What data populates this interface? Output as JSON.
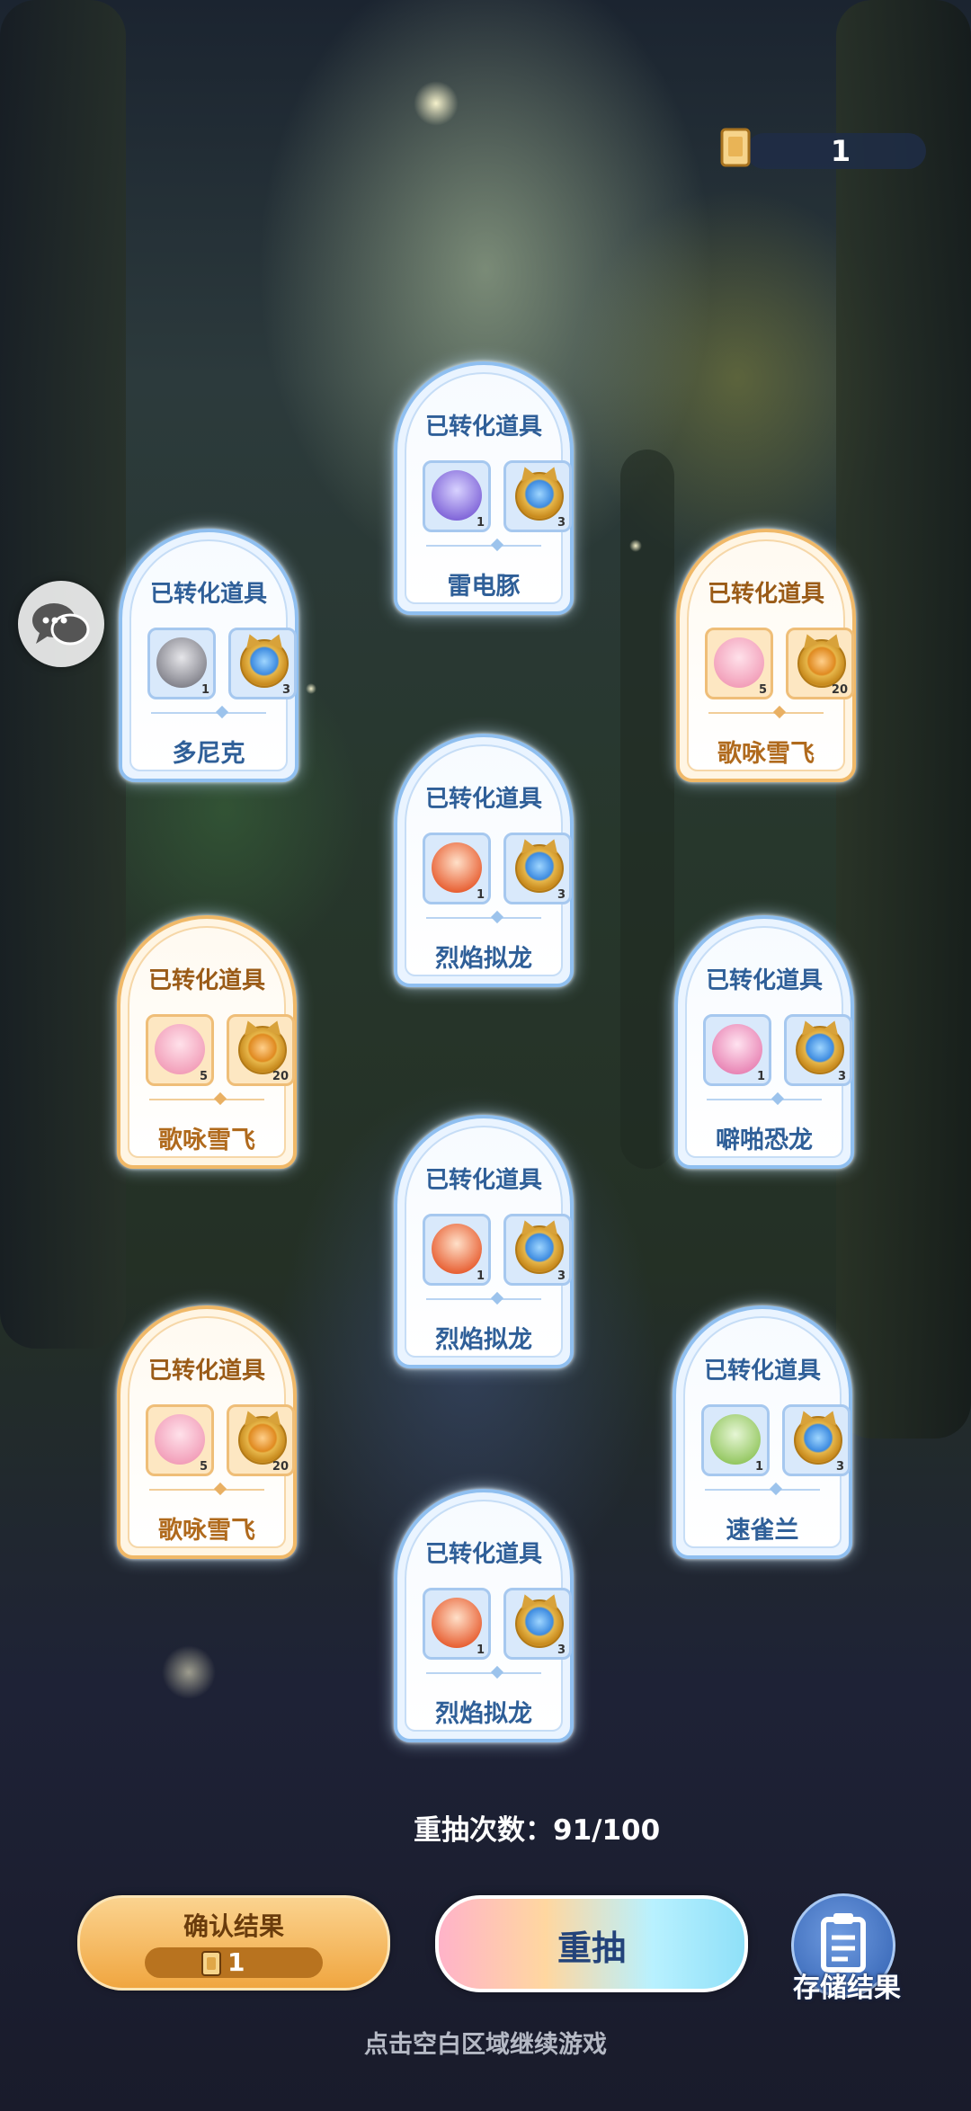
{
  "top_counter": {
    "value": "1",
    "icon": "ticket-icon"
  },
  "chat_button": {
    "icon": "chat-bubbles-icon"
  },
  "cards": [
    {
      "header": "已转化道具",
      "pet_count": "1",
      "item_count": "3",
      "name": "雷电豚",
      "theme": "blue",
      "pet_icon": "purple-pet-icon"
    },
    {
      "header": "已转化道具",
      "pet_count": "1",
      "item_count": "3",
      "name": "多尼克",
      "theme": "blue",
      "pet_icon": "gray-cat-pet-icon"
    },
    {
      "header": "已转化道具",
      "pet_count": "5",
      "item_count": "20",
      "name": "歌咏雪飞",
      "theme": "orange",
      "pet_icon": "pink-pet-icon"
    },
    {
      "header": "已转化道具",
      "pet_count": "1",
      "item_count": "3",
      "name": "烈焰拟龙",
      "theme": "blue",
      "pet_icon": "orange-dragon-pet-icon"
    },
    {
      "header": "已转化道具",
      "pet_count": "5",
      "item_count": "20",
      "name": "歌咏雪飞",
      "theme": "orange",
      "pet_icon": "pink-pet-icon"
    },
    {
      "header": "已转化道具",
      "pet_count": "1",
      "item_count": "3",
      "name": "噼啪恐龙",
      "theme": "blue",
      "pet_icon": "pink-dino-pet-icon"
    },
    {
      "header": "已转化道具",
      "pet_count": "1",
      "item_count": "3",
      "name": "烈焰拟龙",
      "theme": "blue",
      "pet_icon": "orange-dragon-pet-icon"
    },
    {
      "header": "已转化道具",
      "pet_count": "5",
      "item_count": "20",
      "name": "歌咏雪飞",
      "theme": "orange",
      "pet_icon": "pink-pet-icon"
    },
    {
      "header": "已转化道具",
      "pet_count": "1",
      "item_count": "3",
      "name": "速雀兰",
      "theme": "blue",
      "pet_icon": "green-bird-pet-icon"
    },
    {
      "header": "已转化道具",
      "pet_count": "1",
      "item_count": "3",
      "name": "烈焰拟龙",
      "theme": "blue",
      "pet_icon": "orange-dragon-pet-icon"
    }
  ],
  "reroll_count_text": "重抽次数：91/100",
  "confirm_button": {
    "label": "确认结果",
    "cost": "1"
  },
  "reroll_button": {
    "label": "重抽"
  },
  "store_button": {
    "label": "存储结果",
    "icon": "clipboard-icon"
  },
  "hint": "点击空白区域继续游戏"
}
